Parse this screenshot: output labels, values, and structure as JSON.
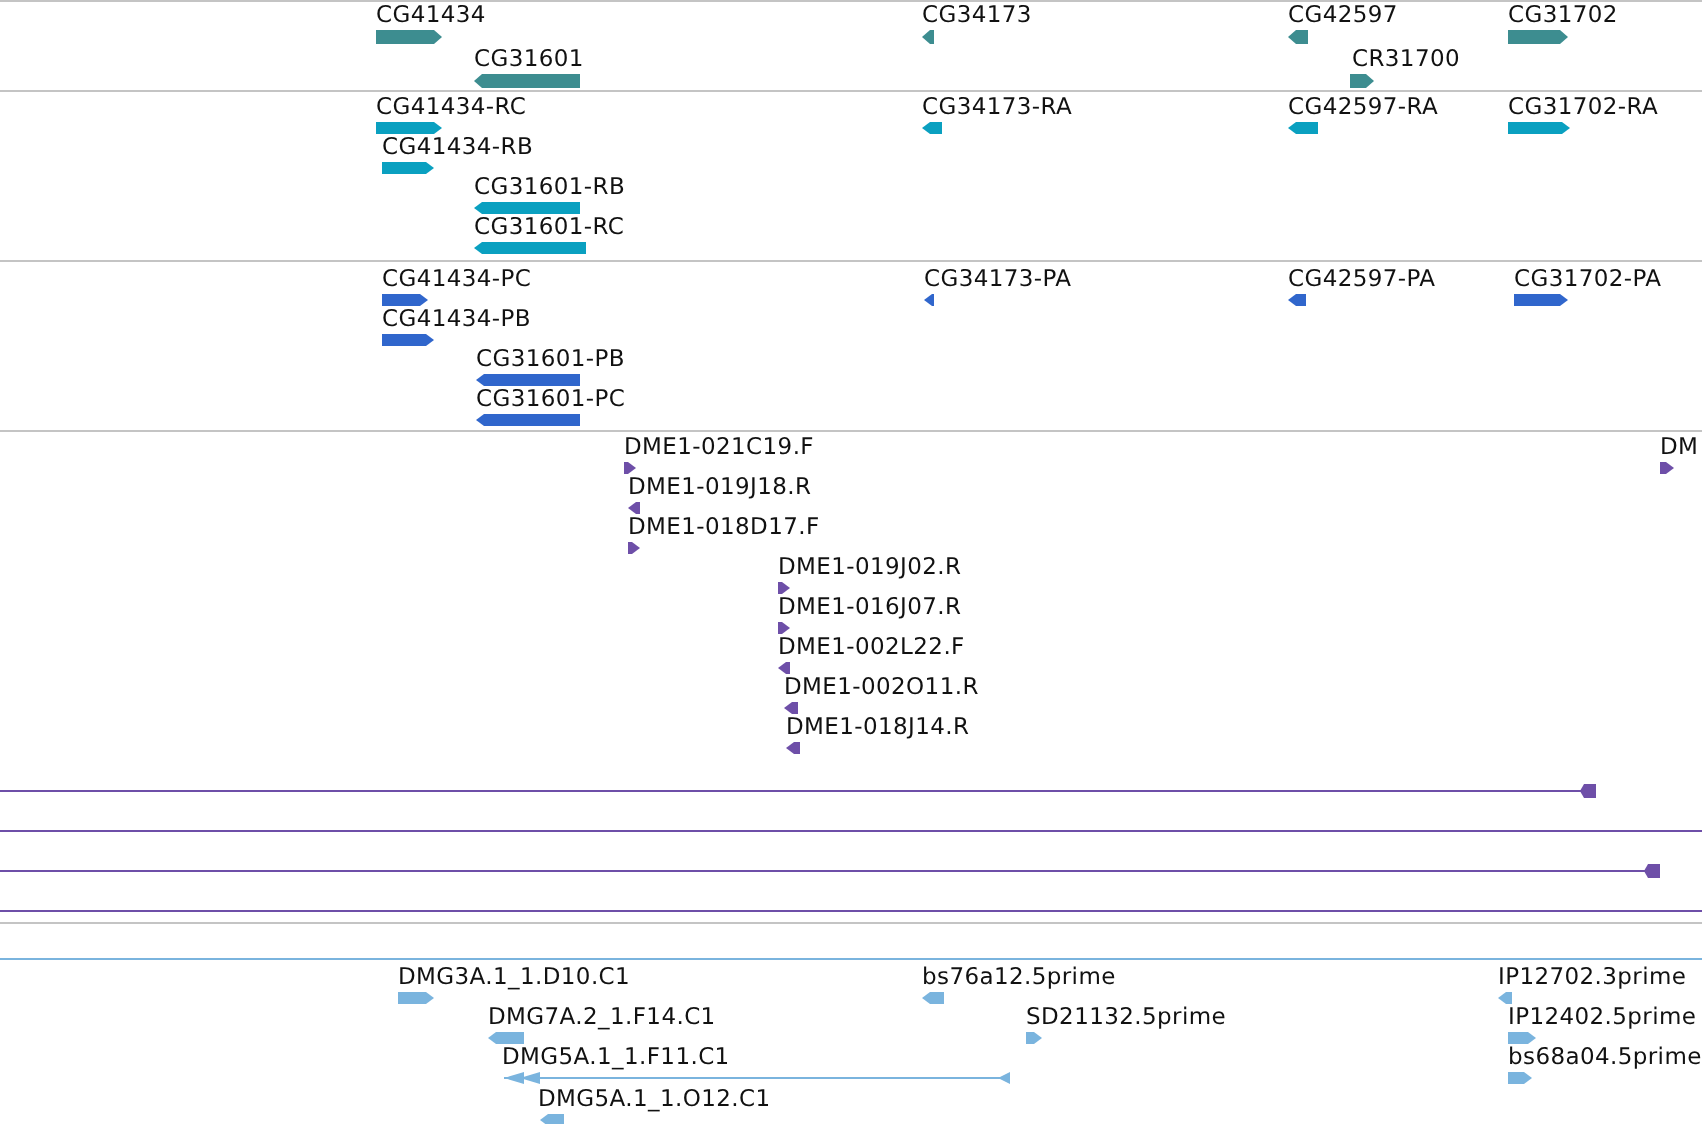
{
  "tracks": [
    {
      "kind": "genes",
      "color": "#3d8d90",
      "features": [
        {
          "label": "CG41434",
          "kind": "forward"
        },
        {
          "label": "CG31601",
          "kind": "reverse"
        },
        {
          "label": "CG34173",
          "kind": "reverse"
        },
        {
          "label": "CG42597",
          "kind": "reverse"
        },
        {
          "label": "CR31700",
          "kind": "forward"
        },
        {
          "label": "CG31702",
          "kind": "forward"
        }
      ]
    },
    {
      "kind": "transcripts",
      "color": "#0aa0c0",
      "features": [
        {
          "label": "CG41434-RC",
          "kind": "forward"
        },
        {
          "label": "CG41434-RB",
          "kind": "forward"
        },
        {
          "label": "CG31601-RB",
          "kind": "reverse"
        },
        {
          "label": "CG31601-RC",
          "kind": "reverse"
        },
        {
          "label": "CG34173-RA",
          "kind": "reverse"
        },
        {
          "label": "CG42597-RA",
          "kind": "reverse"
        },
        {
          "label": "CG31702-RA",
          "kind": "forward"
        }
      ]
    },
    {
      "kind": "proteins",
      "color": "#3066cc",
      "features": [
        {
          "label": "CG41434-PC",
          "kind": "forward"
        },
        {
          "label": "CG41434-PB",
          "kind": "forward"
        },
        {
          "label": "CG31601-PB",
          "kind": "reverse"
        },
        {
          "label": "CG31601-PC",
          "kind": "reverse"
        },
        {
          "label": "CG34173-PA",
          "kind": "reverse"
        },
        {
          "label": "CG42597-PA",
          "kind": "reverse"
        },
        {
          "label": "CG31702-PA",
          "kind": "forward"
        }
      ]
    },
    {
      "kind": "clones",
      "color": "#6e4fa8",
      "features": [
        {
          "label": "DME1-021C19.F",
          "kind": "forward"
        },
        {
          "label": "DME1-019J18.R",
          "kind": "reverse"
        },
        {
          "label": "DME1-018D17.F",
          "kind": "forward"
        },
        {
          "label": "DME1-019J02.R",
          "kind": "forward"
        },
        {
          "label": "DME1-016J07.R",
          "kind": "forward"
        },
        {
          "label": "DME1-002L22.F",
          "kind": "reverse"
        },
        {
          "label": "DME1-002O11.R",
          "kind": "reverse"
        },
        {
          "label": "DME1-018J14.R",
          "kind": "reverse"
        },
        {
          "label": "DM",
          "kind": "forward"
        }
      ],
      "spans": [
        {
          "kind": "capped"
        },
        {
          "kind": "plain"
        },
        {
          "kind": "capped"
        },
        {
          "kind": "plain"
        }
      ]
    },
    {
      "kind": "ests",
      "color": "#7ab4de",
      "features": [
        {
          "label": "DMG3A.1_1.D10.C1",
          "kind": "forward"
        },
        {
          "label": "DMG7A.2_1.F14.C1",
          "kind": "reverse"
        },
        {
          "label": "DMG5A.1_1.F11.C1",
          "kind": "reverse"
        },
        {
          "label": "DMG5A.1_1.O12.C1",
          "kind": "reverse"
        },
        {
          "label": "bs76a12.5prime",
          "kind": "reverse"
        },
        {
          "label": "SD21132.5prime",
          "kind": "forward"
        },
        {
          "label": "IP12702.3prime",
          "kind": "reverse"
        },
        {
          "label": "IP12402.5prime",
          "kind": "forward"
        },
        {
          "label": "bs68a04.5prime",
          "kind": "forward"
        }
      ]
    }
  ]
}
